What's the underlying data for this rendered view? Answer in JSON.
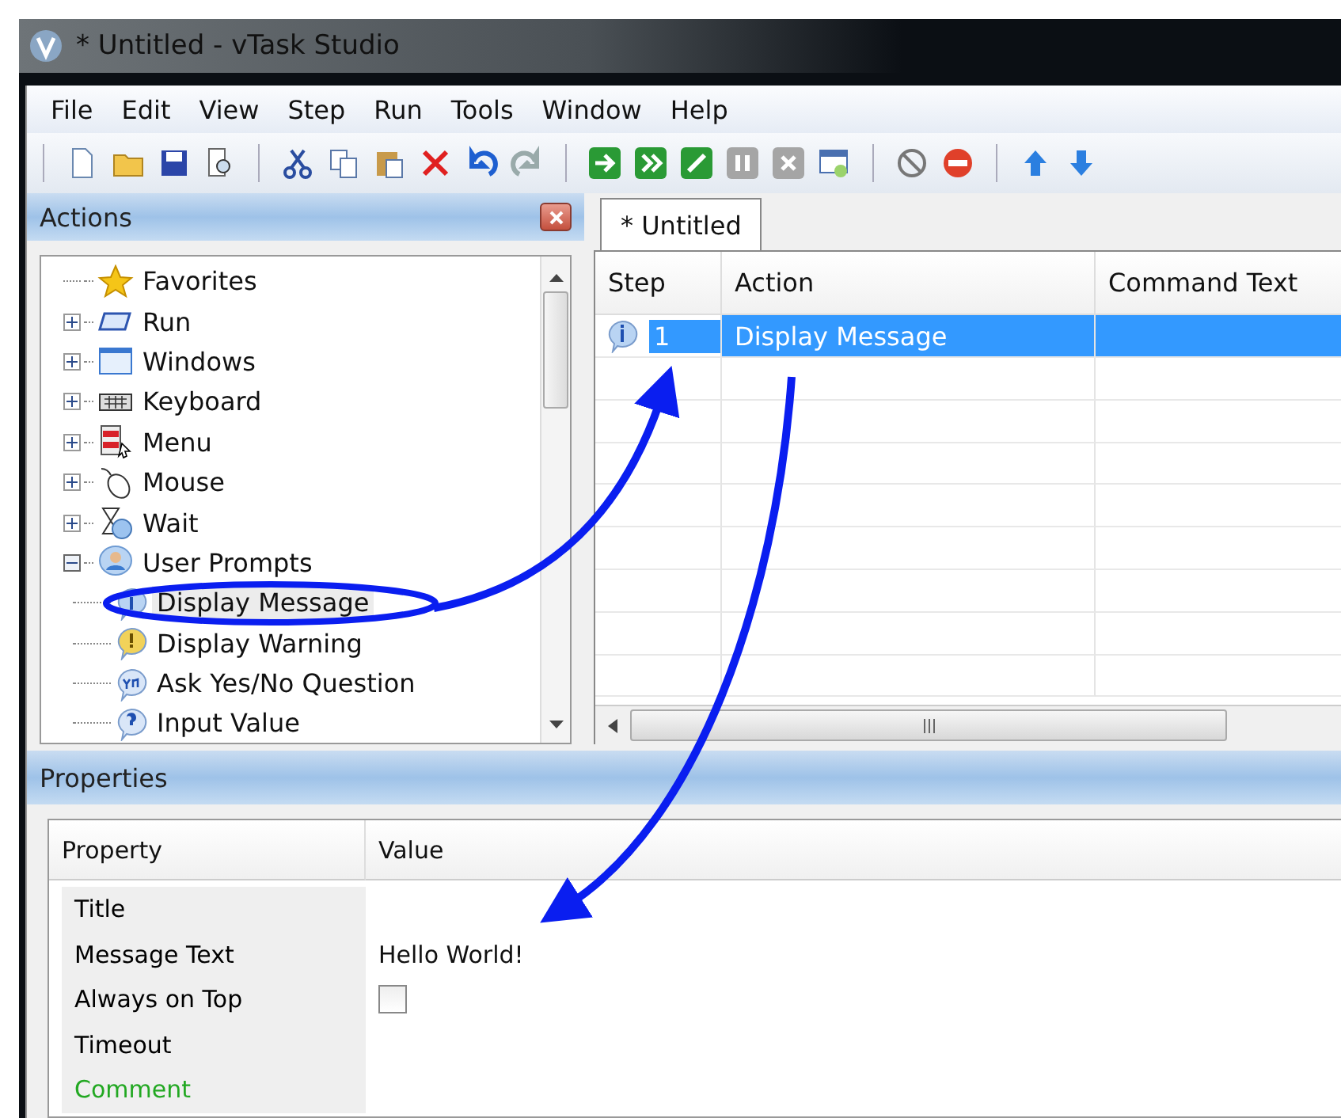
{
  "window": {
    "title": "* Untitled - vTask Studio"
  },
  "menu": [
    "File",
    "Edit",
    "View",
    "Step",
    "Run",
    "Tools",
    "Window",
    "Help"
  ],
  "actions_panel": {
    "title": "Actions",
    "tree": [
      {
        "label": "Favorites",
        "kind": "leaf",
        "selected": false
      },
      {
        "label": "Run",
        "kind": "group",
        "expanded": false,
        "selected": false
      },
      {
        "label": "Windows",
        "kind": "group",
        "expanded": false,
        "selected": false
      },
      {
        "label": "Keyboard",
        "kind": "group",
        "expanded": false,
        "selected": false
      },
      {
        "label": "Menu",
        "kind": "group",
        "expanded": false,
        "selected": false
      },
      {
        "label": "Mouse",
        "kind": "group",
        "expanded": false,
        "selected": false
      },
      {
        "label": "Wait",
        "kind": "group",
        "expanded": false,
        "selected": false
      },
      {
        "label": "User Prompts",
        "kind": "group",
        "expanded": true,
        "selected": false,
        "children": [
          {
            "label": "Display Message",
            "selected": true
          },
          {
            "label": "Display Warning",
            "selected": false
          },
          {
            "label": "Ask Yes/No Question",
            "selected": false
          },
          {
            "label": "Input Value",
            "selected": false
          }
        ]
      }
    ]
  },
  "document_tab": {
    "label": "* Untitled",
    "selected": true
  },
  "steps_table": {
    "columns": [
      "Step",
      "Action",
      "Command Text"
    ],
    "rows": [
      {
        "step": "1",
        "action": "Display Message",
        "selected": true
      }
    ]
  },
  "properties_panel": {
    "title": "Properties",
    "columns": [
      "Property",
      "Value"
    ],
    "rows": [
      {
        "name": "Title",
        "kind": "text",
        "color": "#000000"
      },
      {
        "name": "Message Text",
        "kind": "text",
        "value": "Hello World!",
        "color": "#000000"
      },
      {
        "name": "Always on Top",
        "kind": "checkbox",
        "checked": false,
        "color": "#000000"
      },
      {
        "name": "Timeout",
        "kind": "text",
        "color": "#000000"
      },
      {
        "name": "Comment",
        "kind": "text",
        "color": "#22a822"
      }
    ]
  }
}
